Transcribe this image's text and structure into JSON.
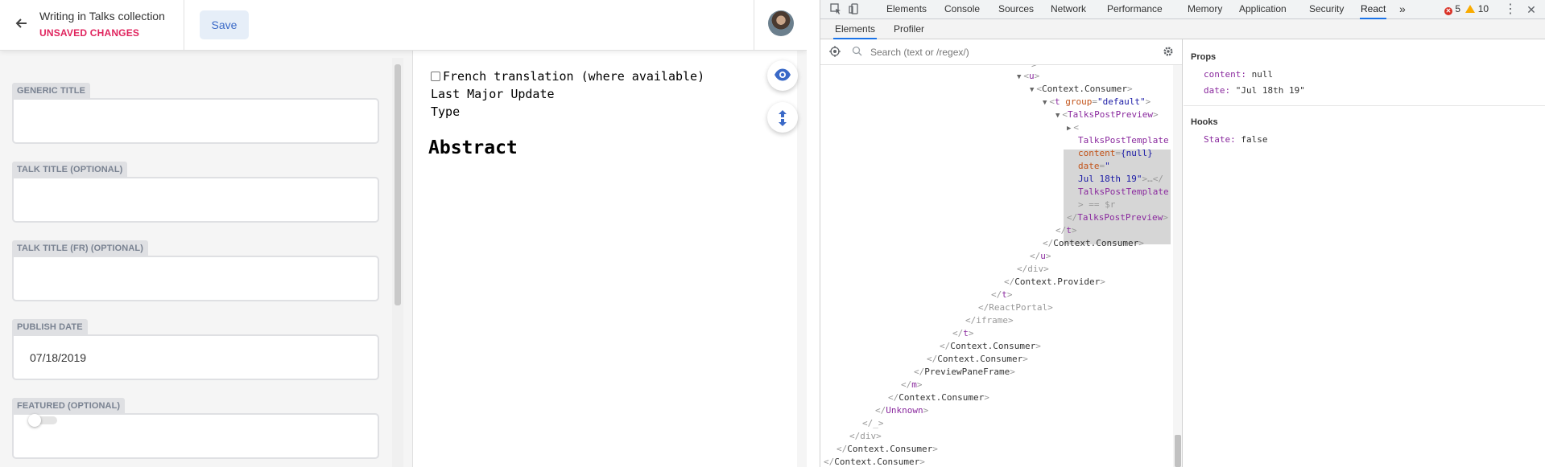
{
  "cms": {
    "header": {
      "title": "Writing in Talks collection",
      "status": "UNSAVED CHANGES",
      "save_label": "Save"
    },
    "fields": [
      {
        "label": "GENERIC TITLE",
        "value": ""
      },
      {
        "label": "TALK TITLE (OPTIONAL)",
        "value": ""
      },
      {
        "label": "TALK TITLE (FR) (OPTIONAL)",
        "value": ""
      },
      {
        "label": "PUBLISH DATE",
        "value": "07/18/2019"
      },
      {
        "label": "FEATURED (OPTIONAL)",
        "toggle_on": false
      }
    ],
    "preview": {
      "checkbox_label": "French translation (where available)",
      "line_last_update": "Last Major Update",
      "line_type": "Type",
      "heading": "Abstract"
    }
  },
  "devtools": {
    "tabs": [
      "Elements",
      "Console",
      "Sources",
      "Network",
      "Performance",
      "Memory",
      "Application",
      "Security",
      "React"
    ],
    "active_tab": "React",
    "more_tabs": "»",
    "error_count": "5",
    "warning_count": "10",
    "react_subtabs": [
      "Elements",
      "Profiler"
    ],
    "active_subtab": "Elements",
    "search": {
      "placeholder": "Search (text or /regex/)"
    },
    "tree": {
      "top_fragment": ">",
      "u_open": "u",
      "ctx_consumer_open": "Context.Consumer",
      "t_open": "t",
      "t_attr_name": "group",
      "t_attr_value": "\"default\"",
      "tpp_open": "TalksPostPreview",
      "sel_name": "TalksPostTemplate",
      "sel_attr1_name": "content",
      "sel_attr1_value": "{null}",
      "sel_attr2_name": "date",
      "sel_attr2_value_a": "\"",
      "sel_attr2_value_b": "Jul 18th 19\"",
      "sel_close_name": "TalksPostTemplate",
      "sel_marker": "== $r",
      "closing_lines": [
        "TalksPostPreview",
        "t",
        "Context.Consumer",
        "u",
        "div",
        "Context.Provider",
        "t",
        "ReactPortal",
        "iframe",
        "t",
        "Context.Consumer",
        "Context.Consumer",
        "PreviewPaneFrame",
        "m",
        "Context.Consumer",
        "Unknown",
        "_",
        "div",
        "Context.Consumer",
        "Context.Consumer"
      ]
    },
    "props": {
      "props_heading": "Props",
      "content_key": "content:",
      "content_val": "null",
      "date_key": "date:",
      "date_val": "\"Jul 18th 19\"",
      "hooks_heading": "Hooks",
      "state_key": "State:",
      "state_val": "false"
    }
  }
}
